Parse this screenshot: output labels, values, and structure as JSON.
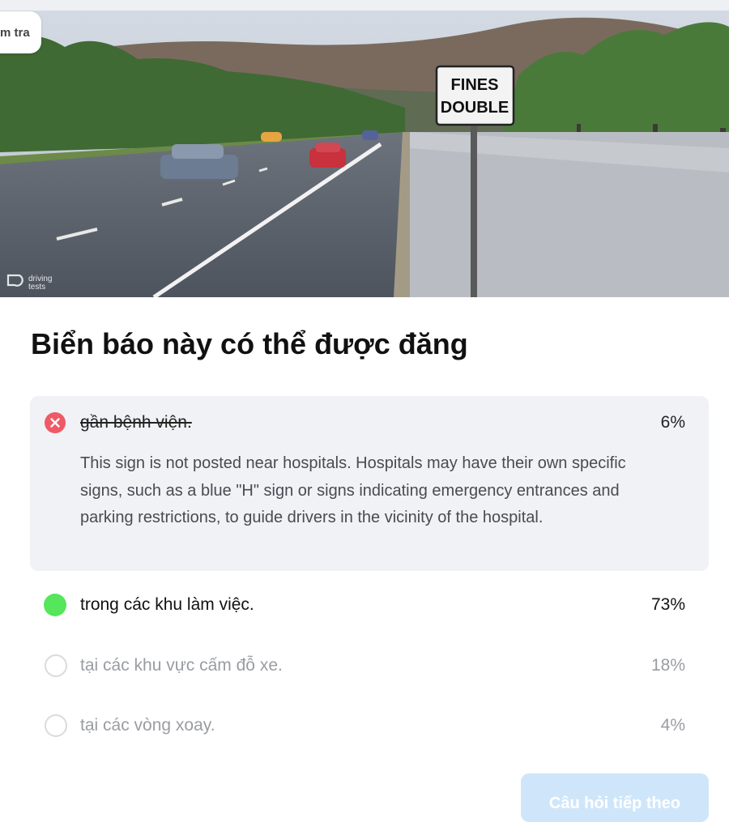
{
  "header": {
    "back_label": "m tra"
  },
  "image": {
    "sign_line1": "FINES",
    "sign_line2": "DOUBLE",
    "watermark_line1": "driving",
    "watermark_line2": "tests"
  },
  "question": {
    "title": "Biển báo này có thể được đăng"
  },
  "answers": [
    {
      "label": "gần bệnh viện.",
      "percent": "6%",
      "state": "wrong",
      "explanation": "This sign is not posted near hospitals. Hospitals may have their own specific signs, such as a blue \"H\" sign or signs indicating emergency entrances and parking restrictions, to guide drivers in the vicinity of the hospital."
    },
    {
      "label": "trong các khu làm việc.",
      "percent": "73%",
      "state": "correct"
    },
    {
      "label": "tại các khu vực cấm đỗ xe.",
      "percent": "18%",
      "state": "neutral"
    },
    {
      "label": "tại các vòng xoay.",
      "percent": "4%",
      "state": "neutral"
    }
  ],
  "footer": {
    "continue_label": "Câu hỏi tiếp theo"
  },
  "colors": {
    "wrong": "#ef5a67",
    "correct": "#55e65b",
    "button": "#cfe6fa"
  }
}
